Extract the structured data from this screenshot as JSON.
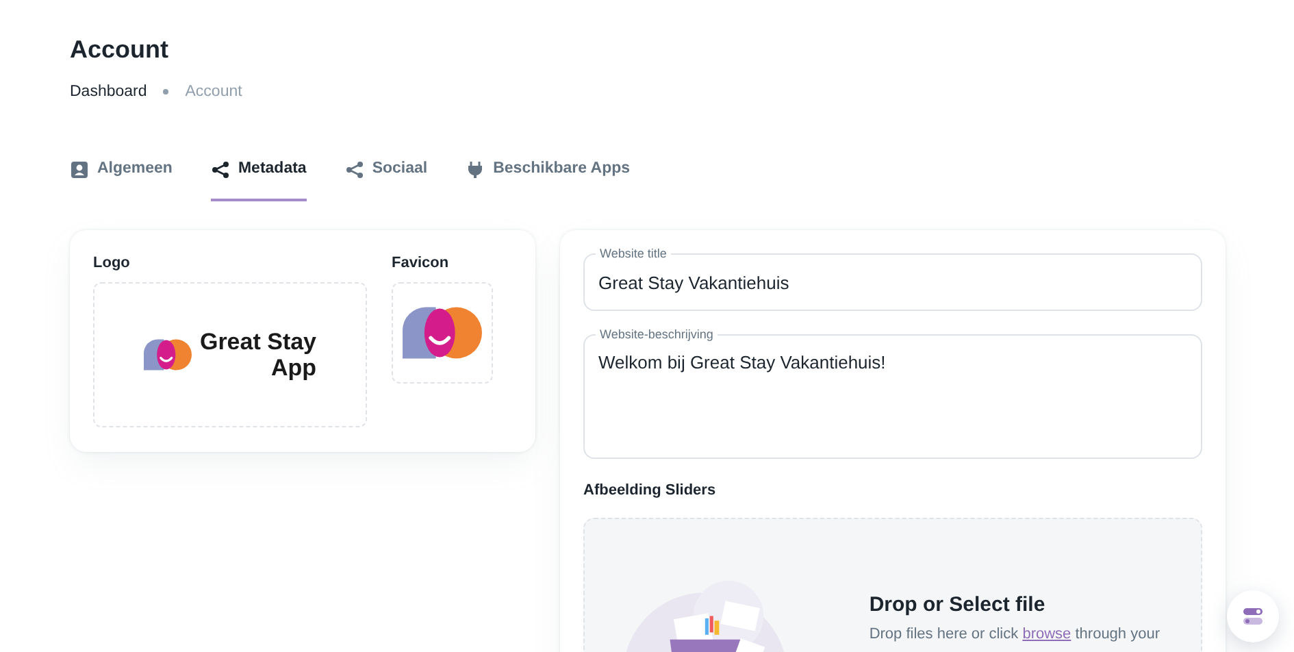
{
  "page": {
    "title": "Account"
  },
  "breadcrumb": [
    "Dashboard",
    "Account"
  ],
  "tabs": [
    {
      "label": "Algemeen",
      "kind": "profile",
      "selected": false
    },
    {
      "label": "Metadata",
      "kind": "share",
      "selected": true
    },
    {
      "label": "Sociaal",
      "kind": "share",
      "selected": false
    },
    {
      "label": "Beschikbare Apps",
      "kind": "plug",
      "selected": false
    }
  ],
  "branding": {
    "logo": {
      "label": "Logo",
      "text_line_1": "Great Stay",
      "text_line_2": "App"
    },
    "favicon": {
      "label": "Favicon"
    }
  },
  "fields": [
    {
      "label": "Website title",
      "value": "Great Stay Vakantiehuis",
      "kind": "input"
    },
    {
      "label": "Website-beschrijving",
      "value": "Welkom bij Great Stay Vakantiehuis!",
      "kind": "textarea"
    }
  ],
  "sliders": {
    "label": "Afbeelding Sliders",
    "dropzone": {
      "title": "Drop or Select file",
      "text_before": "Drop files here or click",
      "link": "browse",
      "text_after": "through your"
    }
  }
}
